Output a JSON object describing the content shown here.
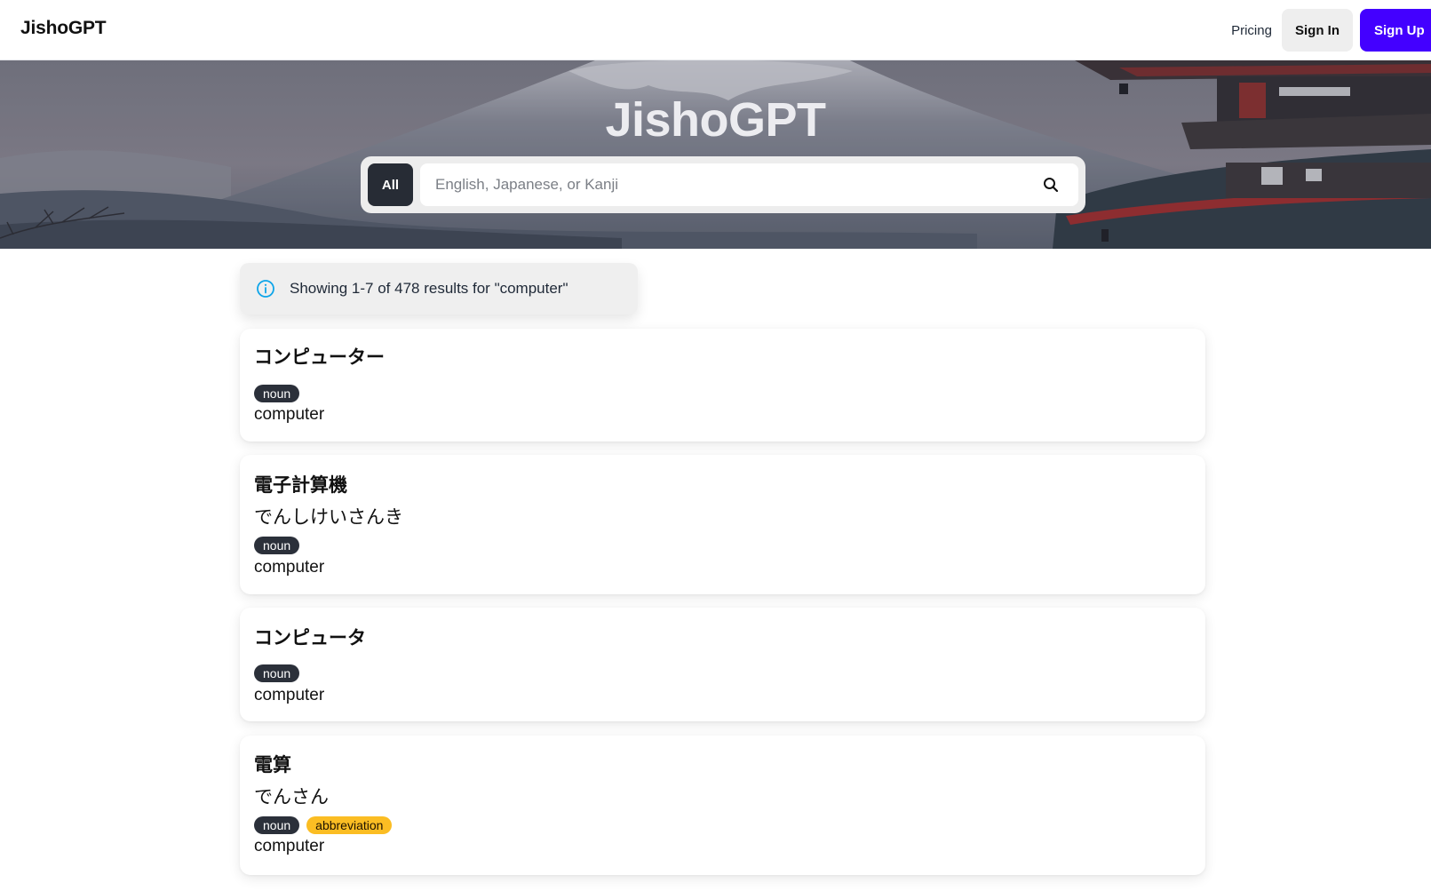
{
  "navbar": {
    "brand": "JishoGPT",
    "pricing": "Pricing",
    "sign_in": "Sign In",
    "sign_up": "Sign Up"
  },
  "hero": {
    "title": "JishoGPT",
    "search": {
      "filter_label": "All",
      "placeholder": "English, Japanese, or Kanji",
      "value": "",
      "icon": "search-icon"
    }
  },
  "results": {
    "summary": "Showing 1-7 of 478 results for \"computer\"",
    "info_icon": "info-icon",
    "items": [
      {
        "word": "コンピューター",
        "reading": "",
        "tags": [
          "noun"
        ],
        "meaning": "computer"
      },
      {
        "word": "電子計算機",
        "reading": "でんしけいさんき",
        "tags": [
          "noun"
        ],
        "meaning": "computer"
      },
      {
        "word": "コンピュータ",
        "reading": "",
        "tags": [
          "noun"
        ],
        "meaning": "computer"
      },
      {
        "word": "電算",
        "reading": "でんさん",
        "tags": [
          "noun",
          "abbreviation"
        ],
        "meaning": "computer"
      }
    ]
  },
  "colors": {
    "accent": "#4300ff",
    "filter_button": "#272c35",
    "noun_tag": "#2b303a",
    "abbreviation_tag": "#fbbd23",
    "info_icon": "#0ea5e9"
  }
}
